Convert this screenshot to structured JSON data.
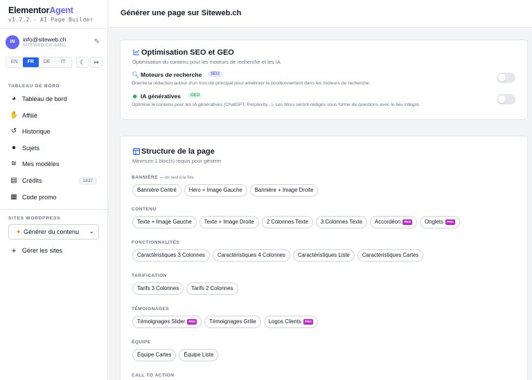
{
  "app": {
    "name_part1": "Elementor",
    "name_part2": "Agent",
    "version": "v1.7.2 - AI Page Builder"
  },
  "user": {
    "initials": "IN",
    "email": "info@siteweb.ch",
    "company": "SITEWEB.CH SARL"
  },
  "languages": [
    {
      "code": "EN",
      "active": false
    },
    {
      "code": "FR",
      "active": true
    },
    {
      "code": "DE",
      "active": false
    },
    {
      "code": "IT",
      "active": false
    }
  ],
  "sidebar": {
    "dashboard_section": "TABLEAU DE BORD",
    "items": [
      {
        "label": "Tableau de bord",
        "icon": "palette-icon"
      },
      {
        "label": "Affilié",
        "icon": "handshake-icon"
      },
      {
        "label": "Historique",
        "icon": "history-icon"
      },
      {
        "label": "Sujets",
        "icon": "lightbulb-icon"
      },
      {
        "label": "Mes modèles",
        "icon": "layers-icon"
      },
      {
        "label": "Crédits",
        "icon": "coins-icon",
        "badge": "1837"
      },
      {
        "label": "Code promo",
        "icon": "gift-icon"
      }
    ],
    "wordpress_section": "SITES WORDPRESS",
    "site_select": "Générer du contenu",
    "manage_sites": "Gérer les sites"
  },
  "header": {
    "title": "Générer une page sur Siteweb.ch"
  },
  "seo_card": {
    "title": "Optimisation SEO et GEO",
    "subtitle": "Optimisation du contenu pour les moteurs de recherche et les IA",
    "options": [
      {
        "title": "Moteurs de recherche",
        "tag": "SEO",
        "desc": "Oriente la rédaction autour d'un mot-clé principal pour améliorer le positionnement dans les moteurs de recherche.",
        "enabled": false
      },
      {
        "title": "IA génératives",
        "tag": "GEO",
        "desc": "Optimise le contenu pour les IA génératives (ChatGPT, Perplexity...). Les titres seront rédigés sous forme de questions avec le lieu intégré.",
        "enabled": false
      }
    ]
  },
  "structure_card": {
    "title": "Structure de la page",
    "subtitle": "Minimum 1 bloc(s) requis pour générer",
    "pro_label": "PRO",
    "groups": [
      {
        "label": "BANNIÈRE",
        "hint": "— un seul à la fois",
        "chips": [
          {
            "label": "Bannière Centré"
          },
          {
            "label": "Hero + Image Gauche"
          },
          {
            "label": "Bannière + Image Droite"
          }
        ]
      },
      {
        "label": "CONTENU",
        "chips": [
          {
            "label": "Texte + Image Gauche"
          },
          {
            "label": "Texte + Image Droite"
          },
          {
            "label": "2 Colonnes Texte"
          },
          {
            "label": "3 Colonnes Texte"
          },
          {
            "label": "Accordéon",
            "pro": true
          },
          {
            "label": "Onglets",
            "pro": true
          }
        ]
      },
      {
        "label": "FONCTIONNALITÉS",
        "chips": [
          {
            "label": "Caractéristiques 3 Colonnes"
          },
          {
            "label": "Caractéristiques 4 Colonnes"
          },
          {
            "label": "Caractéristiques Liste"
          },
          {
            "label": "Caractéristiques Cartes"
          }
        ]
      },
      {
        "label": "TARIFICATION",
        "chips": [
          {
            "label": "Tarifs 3 Colonnes"
          },
          {
            "label": "Tarifs 2 Colonnes"
          }
        ]
      },
      {
        "label": "TÉMOIGNAGES",
        "chips": [
          {
            "label": "Témoignages Slider",
            "pro": true
          },
          {
            "label": "Témoignages Grille"
          },
          {
            "label": "Logos Clients",
            "pro": true
          }
        ]
      },
      {
        "label": "ÉQUIPE",
        "chips": [
          {
            "label": "Équipe Cartes"
          },
          {
            "label": "Équipe Liste"
          }
        ]
      },
      {
        "label": "CALL TO ACTION",
        "chips": []
      }
    ]
  }
}
